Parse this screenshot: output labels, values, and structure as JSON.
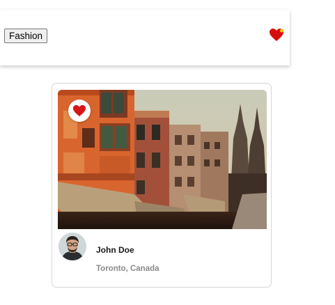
{
  "header": {
    "category_button_label": "Fashion",
    "favorites_icon": "heart-icon",
    "favorites_color": "#e01010"
  },
  "card": {
    "image_icon": "heart-icon",
    "image_description_icon": "photo",
    "user": {
      "name": "John Doe",
      "location": "Toronto, Canada",
      "avatar_icon": "user-avatar"
    }
  },
  "colors": {
    "heart": "#d41616",
    "card_border": "#d6d6d6",
    "location_text": "#8a8a8a"
  }
}
